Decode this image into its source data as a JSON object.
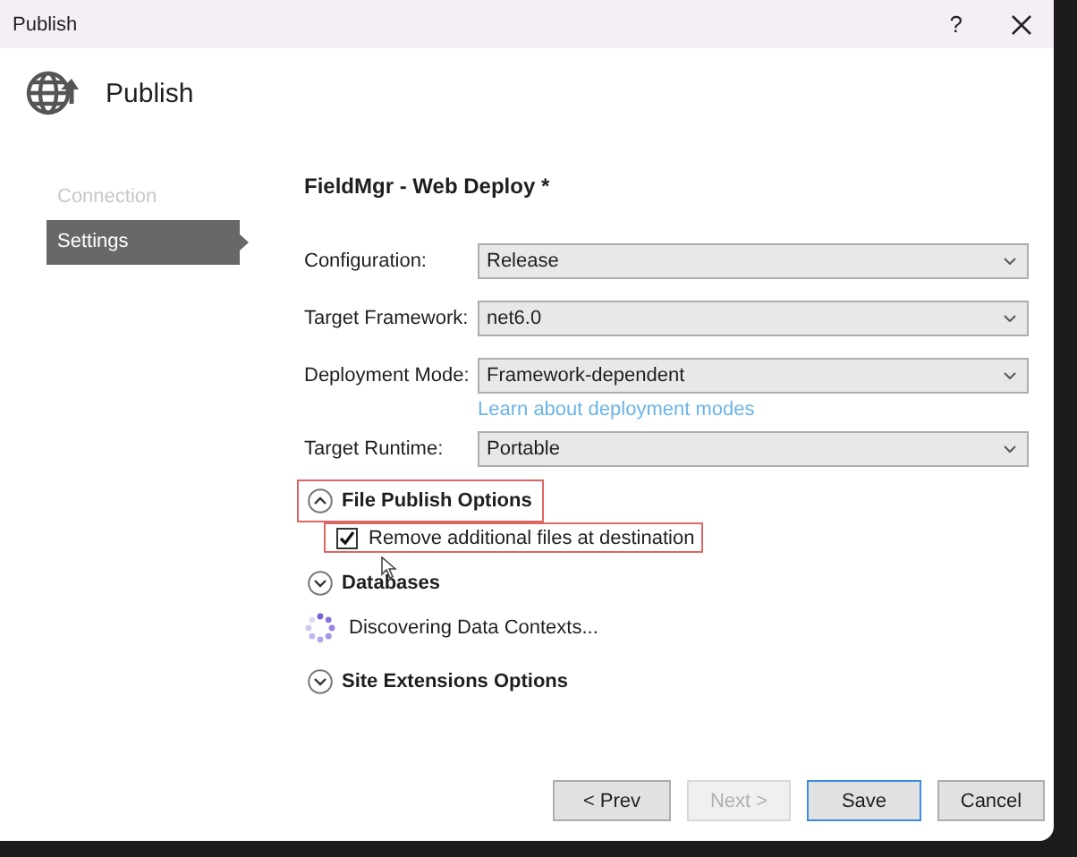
{
  "window": {
    "title": "Publish",
    "help": "?"
  },
  "header": {
    "title": "Publish"
  },
  "sidebar": {
    "items": [
      {
        "label": "Connection",
        "selected": false,
        "disabled": true
      },
      {
        "label": "Settings",
        "selected": true,
        "disabled": false
      }
    ]
  },
  "profile": {
    "title": "FieldMgr - Web Deploy *"
  },
  "fields": [
    {
      "label": "Configuration:",
      "value": "Release"
    },
    {
      "label": "Target Framework:",
      "value": "net6.0"
    },
    {
      "label": "Deployment Mode:",
      "value": "Framework-dependent",
      "link": "Learn about deployment modes"
    },
    {
      "label": "Target Runtime:",
      "value": "Portable"
    }
  ],
  "sections": [
    {
      "title": "File Publish Options",
      "expanded": true,
      "highlighted": true,
      "options": [
        {
          "label": "Remove additional files at destination",
          "checked": true,
          "highlighted": true
        }
      ]
    },
    {
      "title": "Databases",
      "expanded": false,
      "highlighted": false,
      "status": {
        "kind": "loading",
        "text": "Discovering Data Contexts..."
      }
    },
    {
      "title": "Site Extensions Options",
      "expanded": false,
      "highlighted": false
    }
  ],
  "buttons": [
    {
      "label": "< Prev",
      "disabled": false,
      "default": false
    },
    {
      "label": "Next >",
      "disabled": true,
      "default": false
    },
    {
      "label": "Save",
      "disabled": false,
      "default": true
    },
    {
      "label": "Cancel",
      "disabled": false,
      "default": false
    }
  ]
}
